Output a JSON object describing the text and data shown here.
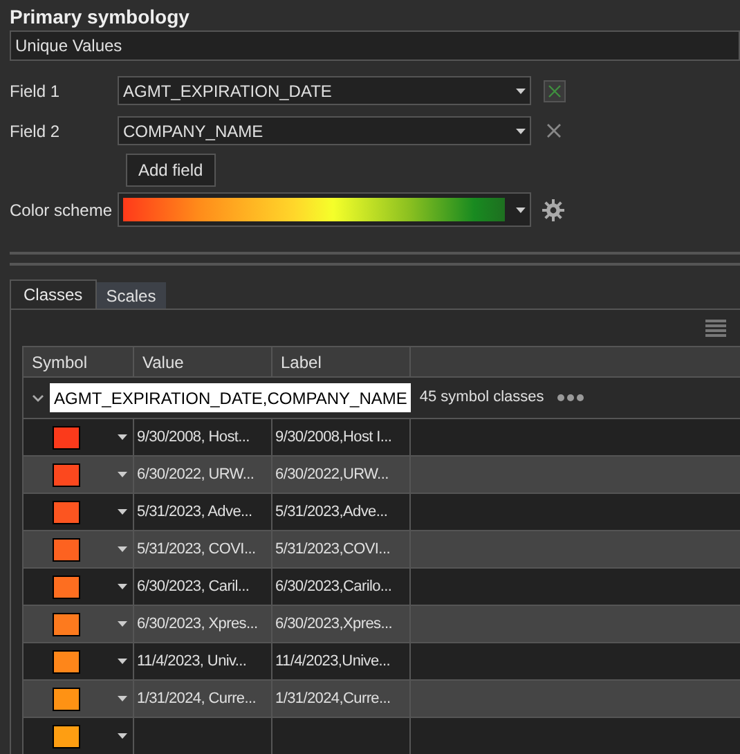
{
  "panel_title": "Primary symbology",
  "method": {
    "value": "Unique Values"
  },
  "fields": [
    {
      "label": "Field 1",
      "value": "AGMT_EXPIRATION_DATE",
      "kind": "expression"
    },
    {
      "label": "Field 2",
      "value": "COMPANY_NAME",
      "kind": "remove"
    }
  ],
  "add_field_button": "Add field",
  "color_scheme": {
    "label": "Color scheme"
  },
  "tabs": [
    {
      "label": "Classes",
      "selected": true
    },
    {
      "label": "Scales",
      "selected": false
    }
  ],
  "table": {
    "columns": [
      "Symbol",
      "Value",
      "Label"
    ],
    "group": {
      "heading": "AGMT_EXPIRATION_DATE,COMPANY_NAME",
      "count": "45 symbol classes",
      "expanded": true
    },
    "rows": [
      {
        "color": "#fb3a1b",
        "value": "9/30/2008, Host...",
        "label": "9/30/2008,Host I..."
      },
      {
        "color": "#fc481e",
        "value": "6/30/2022, URW...",
        "label": "6/30/2022,URW..."
      },
      {
        "color": "#fc5520",
        "value": "5/31/2023, Adve...",
        "label": "5/31/2023,Adve..."
      },
      {
        "color": "#fd6220",
        "value": "5/31/2023, COVI...",
        "label": "5/31/2023,COVI..."
      },
      {
        "color": "#fd6e20",
        "value": "6/30/2023, Caril...",
        "label": "6/30/2023,Carilo..."
      },
      {
        "color": "#fd7a1e",
        "value": "6/30/2023, Xpres...",
        "label": "6/30/2023,Xpres..."
      },
      {
        "color": "#fe861a",
        "value": "11/4/2023, Univ...",
        "label": "11/4/2023,Unive..."
      },
      {
        "color": "#fe9214",
        "value": "1/31/2024, Curre...",
        "label": "1/31/2024,Curre..."
      },
      {
        "color": "#fe9e12"
      }
    ]
  }
}
